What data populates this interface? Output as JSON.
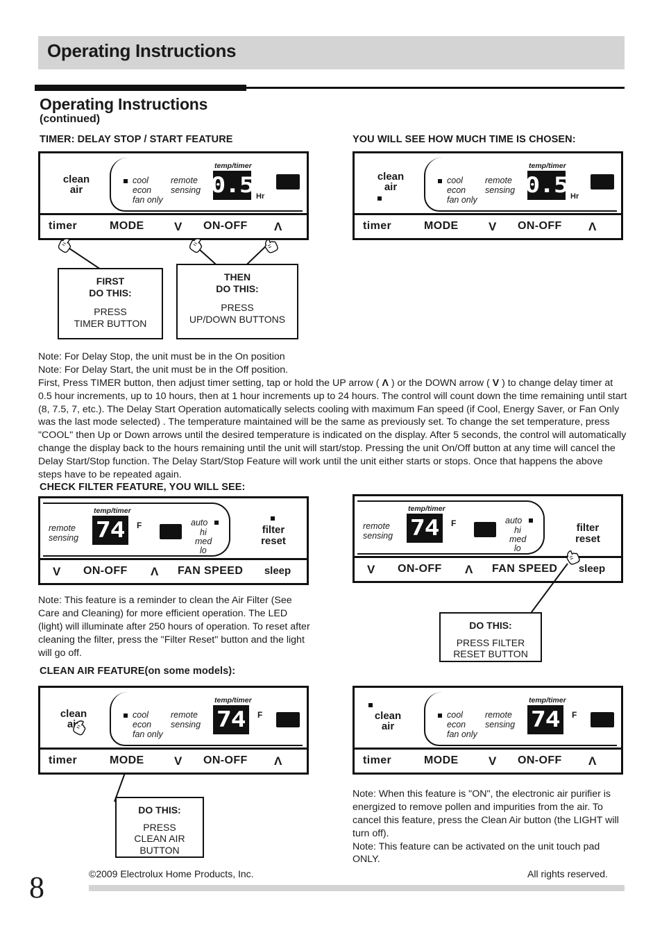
{
  "header": {
    "title": "Operating Instructions"
  },
  "section": {
    "title": "Operating Instructions",
    "subtitle": "(continued)"
  },
  "headings": {
    "timer": "TIMER: DELAY STOP / START FEATURE",
    "time_chosen": "YOU WILL SEE HOW MUCH TIME IS CHOSEN:",
    "check_filter": "CHECK FILTER FEATURE, YOU WILL SEE:",
    "clean_air": "CLEAN AIR FEATURE(on some models):"
  },
  "panel_labels": {
    "clean_air": "clean\nair",
    "clean": "clean",
    "air": "air",
    "timer": "timer",
    "mode": "MODE",
    "on_off": "ON-OFF",
    "down_arrow": "V",
    "up_arrow": "Λ",
    "cool": "cool",
    "econ": "econ",
    "fan_only": "fan only",
    "remote": "remote",
    "sensing": "sensing",
    "temp_timer": "temp/timer",
    "hr": "Hr",
    "f": "F",
    "auto": "auto",
    "hi": "hi",
    "med": "med",
    "lo": "lo",
    "fan_speed": "FAN SPEED",
    "sleep": "sleep",
    "filter": "filter",
    "reset": "reset"
  },
  "displays": {
    "timer_value": "0.5",
    "temp_value": "74"
  },
  "callouts": {
    "first": {
      "title": "FIRST\nDO THIS:",
      "title_l1": "FIRST",
      "title_l2": "DO THIS:",
      "body_l1": "PRESS",
      "body_l2": "TIMER BUTTON"
    },
    "then": {
      "title_l1": "THEN",
      "title_l2": "DO THIS:",
      "body_l1": "PRESS",
      "body_l2": "UP/DOWN BUTTONS"
    },
    "filter": {
      "title": "DO THIS:",
      "body_l1": "PRESS FILTER",
      "body_l2": "RESET BUTTON"
    },
    "cleanair": {
      "title": "DO THIS:",
      "body_l1": "PRESS",
      "body_l2": "CLEAN AIR",
      "body_l3": "BUTTON"
    }
  },
  "notes": {
    "timer_line1": "Note: For Delay Stop, the unit must be in the On position",
    "timer_line2": "Note: For Delay Start, the unit must be in the Off position.",
    "timer_body_a": "First, Press TIMER button, then adjust timer setting, tap or hold the UP arrow ( ",
    "timer_body_up": "Λ",
    "timer_body_b": " ) or the DOWN arrow ( ",
    "timer_body_down": "V",
    "timer_body_c": " ) to change delay timer at 0.5 hour increments, up to 10 hours, then at 1 hour increments up to 24 hours. The control will count down the time remaining until start (8, 7.5, 7, etc.). The Delay Start Operation automatically selects cooling with maximum Fan speed (if Cool, Energy Saver, or Fan Only was the last mode selected) . The temperature maintained will be the same as previously set. To change the set temperature, press \"COOL\" then Up or Down arrows until the desired temperature is indicated on the display. After 5 seconds, the control will automatically change the display back to the hours remaining until the unit will start/stop. Pressing the unit On/Off button at any time will cancel the Delay Start/Stop function. The Delay Start/Stop Feature will work until the unit either starts or stops. Once that happens the above steps have to be repeated again.",
    "filter_note": "Note: This feature is a reminder to clean the Air Filter (See Care and Cleaning) for more efficient operation. The LED (light) will illuminate after 250 hours of operation. To reset after cleaning the filter, press the \"Filter Reset\" button and the light will go off.",
    "cleanair_note_1": "Note: When this feature is \"ON\", the electronic air purifier is energized to remove pollen and impurities from the air. To cancel this feature, press the Clean Air button (the LIGHT will turn off).",
    "cleanair_note_2": "Note: This feature can be activated on the unit touch pad ONLY."
  },
  "footer": {
    "page_number": "8",
    "copyright": "©2009 Electrolux Home Products, Inc.",
    "rights": "All rights reserved."
  }
}
